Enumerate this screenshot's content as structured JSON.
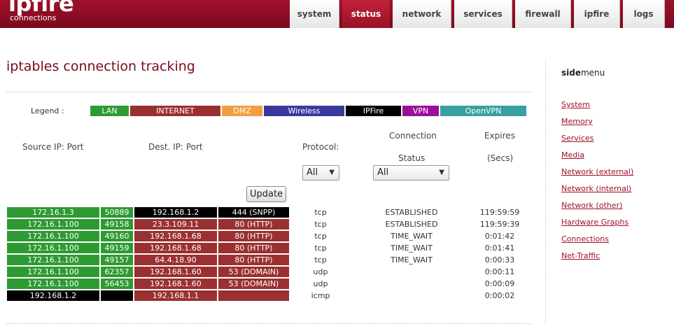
{
  "header": {
    "logo": "ipfire",
    "subtitle": "connections",
    "tabs": [
      {
        "label": "system",
        "active": false
      },
      {
        "label": "status",
        "active": true
      },
      {
        "label": "network",
        "active": false
      },
      {
        "label": "services",
        "active": false
      },
      {
        "label": "firewall",
        "active": false
      },
      {
        "label": "ipfire",
        "active": false
      },
      {
        "label": "logs",
        "active": false
      }
    ]
  },
  "page_title": "iptables connection tracking",
  "legend": {
    "label": "Legend :",
    "items": [
      {
        "label": "LAN",
        "color": "#2e9a32"
      },
      {
        "label": "INTERNET",
        "color": "#9b3030"
      },
      {
        "label": "DMZ",
        "color": "#f0a040"
      },
      {
        "label": "Wireless",
        "color": "#3a3a9e"
      },
      {
        "label": "IPFire",
        "color": "#000000"
      },
      {
        "label": "VPN",
        "color": "#9a109a"
      },
      {
        "label": "OpenVPN",
        "color": "#3aa0a0"
      }
    ]
  },
  "columns": {
    "source": "Source IP: Port",
    "dest": "Dest. IP: Port",
    "protocol": "Protocol:",
    "connection": "Connection",
    "status": "Status",
    "expires": "Expires",
    "secs": "(Secs)"
  },
  "filters": {
    "protocol_value": "All",
    "status_value": "All",
    "update_label": "Update"
  },
  "rows": [
    {
      "src_ip": "172.16.1.3",
      "src_port": "50889",
      "src_color": "#2e9a32",
      "dst_ip": "192.168.1.2",
      "dst_port": "444 (SNPP)",
      "dst_color": "#000000",
      "protocol": "tcp",
      "status": "ESTABLISHED",
      "expires": "119:59:59"
    },
    {
      "src_ip": "172.16.1.100",
      "src_port": "49158",
      "src_color": "#2e9a32",
      "dst_ip": "23.3.109.11",
      "dst_port": "80 (HTTP)",
      "dst_color": "#9b3030",
      "protocol": "tcp",
      "status": "ESTABLISHED",
      "expires": "119:59:39"
    },
    {
      "src_ip": "172.16.1.100",
      "src_port": "49160",
      "src_color": "#2e9a32",
      "dst_ip": "192.168.1.68",
      "dst_port": "80 (HTTP)",
      "dst_color": "#9b3030",
      "protocol": "tcp",
      "status": "TIME_WAIT",
      "expires": "0:01:42"
    },
    {
      "src_ip": "172.16.1.100",
      "src_port": "49159",
      "src_color": "#2e9a32",
      "dst_ip": "192.168.1.68",
      "dst_port": "80 (HTTP)",
      "dst_color": "#9b3030",
      "protocol": "tcp",
      "status": "TIME_WAIT",
      "expires": "0:01:41"
    },
    {
      "src_ip": "172.16.1.100",
      "src_port": "49157",
      "src_color": "#2e9a32",
      "dst_ip": "64.4.18.90",
      "dst_port": "80 (HTTP)",
      "dst_color": "#9b3030",
      "protocol": "tcp",
      "status": "TIME_WAIT",
      "expires": "0:00:33"
    },
    {
      "src_ip": "172.16.1.100",
      "src_port": "62357",
      "src_color": "#2e9a32",
      "dst_ip": "192.168.1.60",
      "dst_port": "53 (DOMAIN)",
      "dst_color": "#9b3030",
      "protocol": "udp",
      "status": "",
      "expires": "0:00:11"
    },
    {
      "src_ip": "172.16.1.100",
      "src_port": "56453",
      "src_color": "#2e9a32",
      "dst_ip": "192.168.1.60",
      "dst_port": "53 (DOMAIN)",
      "dst_color": "#9b3030",
      "protocol": "udp",
      "status": "",
      "expires": "0:00:09"
    },
    {
      "src_ip": "192.168.1.2",
      "src_port": "",
      "src_color": "#000000",
      "dst_ip": "192.168.1.1",
      "dst_port": "",
      "dst_color": "#9b3030",
      "protocol": "icmp",
      "status": "",
      "expires": "0:00:02"
    }
  ],
  "sidemenu": {
    "title_bold": "side",
    "title_rest": "menu",
    "links": [
      "System",
      "Memory",
      "Services",
      "Media",
      "Network (external)",
      "Network (internal)",
      "Network (other)",
      "Hardware Graphs",
      "Connections",
      "Net-Traffic"
    ]
  }
}
